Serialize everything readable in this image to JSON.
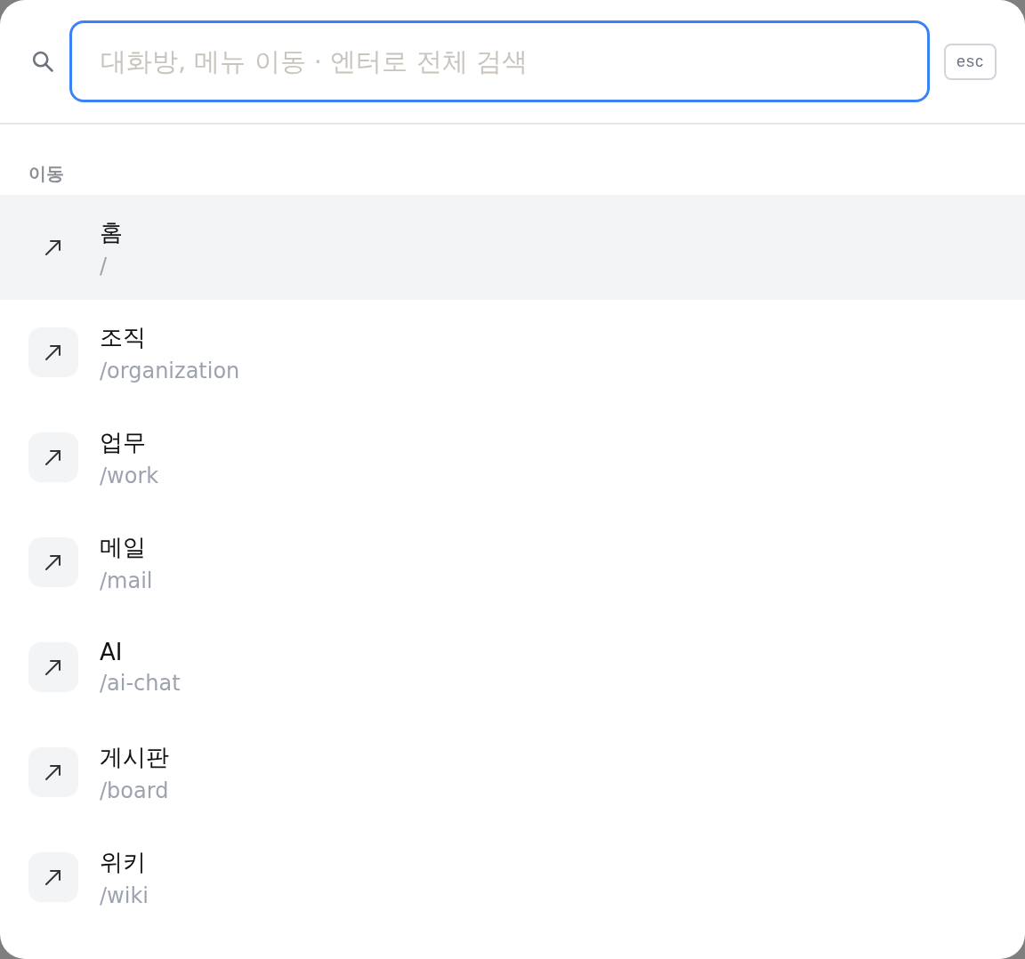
{
  "search": {
    "placeholder": "대화방, 메뉴 이동 · 엔터로 전체 검색"
  },
  "close_key": "esc",
  "section": {
    "title": "이동",
    "items": [
      {
        "title": "홈",
        "path": "/",
        "selected": true
      },
      {
        "title": "조직",
        "path": "/organization",
        "selected": false
      },
      {
        "title": "업무",
        "path": "/work",
        "selected": false
      },
      {
        "title": "메일",
        "path": "/mail",
        "selected": false
      },
      {
        "title": "AI",
        "path": "/ai-chat",
        "selected": false
      },
      {
        "title": "게시판",
        "path": "/board",
        "selected": false
      },
      {
        "title": "위키",
        "path": "/wiki",
        "selected": false
      }
    ]
  }
}
